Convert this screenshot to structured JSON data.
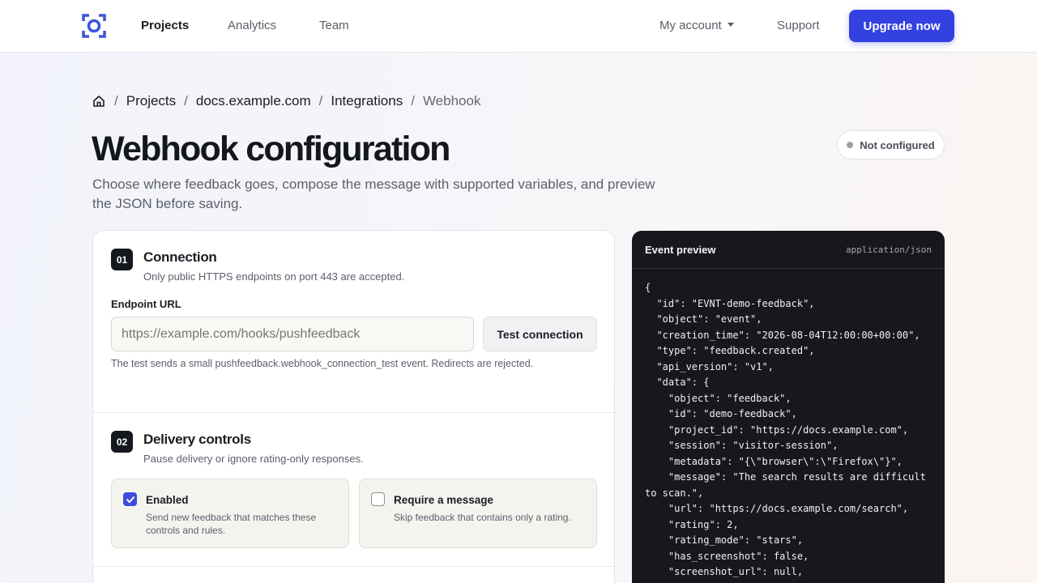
{
  "nav": {
    "items": [
      {
        "label": "Projects",
        "active": true
      },
      {
        "label": "Analytics",
        "active": false
      },
      {
        "label": "Team",
        "active": false
      }
    ],
    "account_label": "My account",
    "support_label": "Support",
    "upgrade_label": "Upgrade now"
  },
  "breadcrumb": {
    "home_icon": "home-icon",
    "items": [
      "Projects",
      "docs.example.com",
      "Integrations",
      "Webhook"
    ]
  },
  "page": {
    "title": "Webhook configuration",
    "subtitle": "Choose where feedback goes, compose the message with supported variables, and preview the JSON before saving.",
    "status": "Not configured"
  },
  "connection": {
    "step": "01",
    "title": "Connection",
    "description": "Only public HTTPS endpoints on port 443 are accepted.",
    "endpoint_label": "Endpoint URL",
    "endpoint_placeholder": "https://example.com/hooks/pushfeedback",
    "endpoint_value": "",
    "test_button": "Test connection",
    "help": "The test sends a small pushfeedback.webhook_connection_test event. Redirects are rejected."
  },
  "delivery": {
    "step": "02",
    "title": "Delivery controls",
    "description": "Pause delivery or ignore rating-only responses.",
    "options": [
      {
        "title": "Enabled",
        "description": "Send new feedback that matches these controls and rules.",
        "checked": true
      },
      {
        "title": "Require a message",
        "description": "Skip feedback that contains only a rating.",
        "checked": false
      }
    ]
  },
  "preview": {
    "title": "Event preview",
    "content_type": "application/json",
    "lines": [
      "{",
      "  \"id\": \"EVNT-demo-feedback\",",
      "  \"object\": \"event\",",
      "  \"creation_time\": \"2026-08-04T12:00:00+00:00\",",
      "  \"type\": \"feedback.created\",",
      "  \"api_version\": \"v1\",",
      "  \"data\": {",
      "    \"object\": \"feedback\",",
      "    \"id\": \"demo-feedback\",",
      "    \"project_id\": \"https://docs.example.com\",",
      "    \"session\": \"visitor-session\",",
      "    \"metadata\": \"{\\\"browser\\\":\\\"Firefox\\\"}\",",
      "    \"message\": \"The search results are difficult to scan.\",",
      "    \"url\": \"https://docs.example.com/search\",",
      "    \"rating\": 2,",
      "    \"rating_mode\": \"stars\",",
      "    \"has_screenshot\": false,",
      "    \"screenshot_url\": null,"
    ]
  },
  "colors": {
    "accent": "#3341e0",
    "panel_dark": "#17171d",
    "checkbox": "#3d4ce0"
  }
}
